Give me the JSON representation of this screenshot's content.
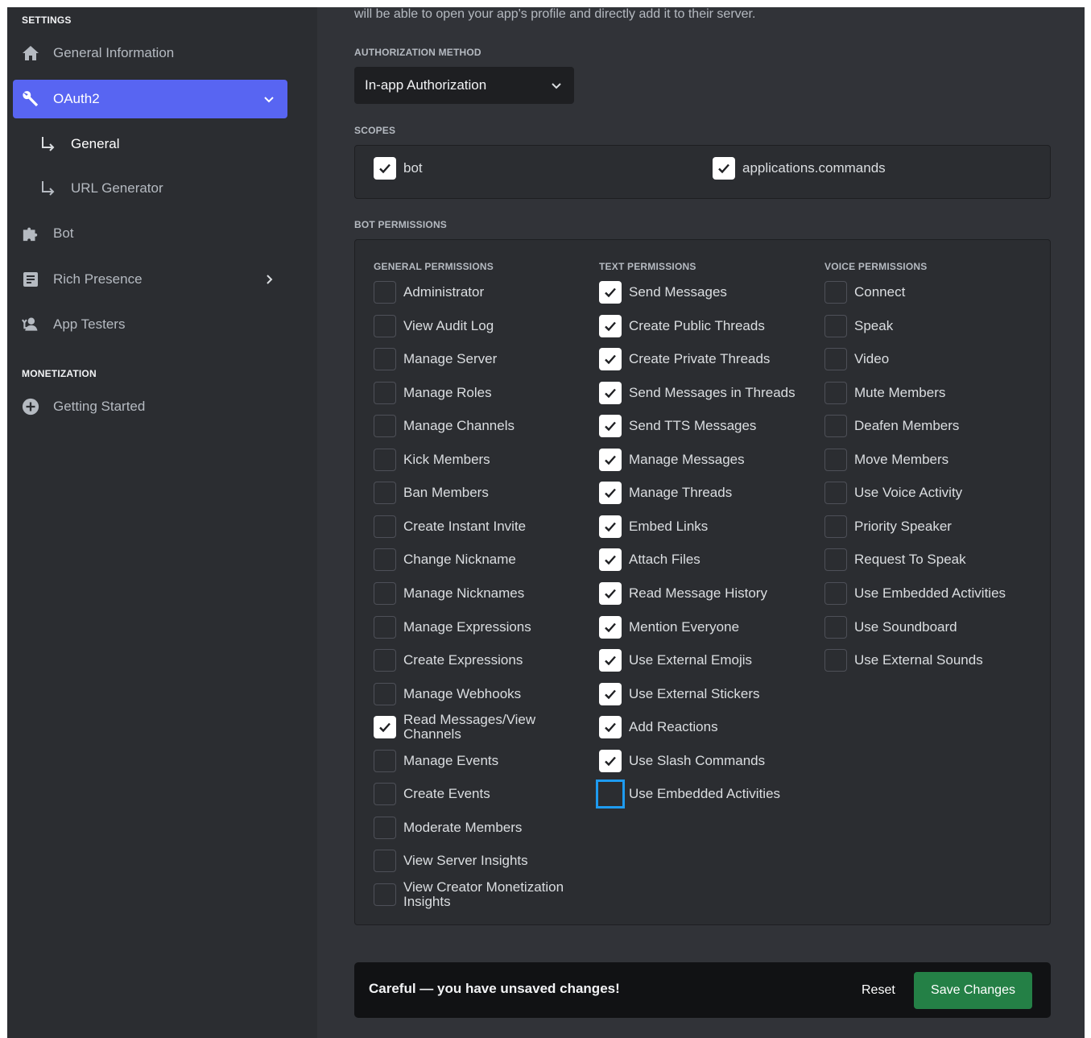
{
  "sidebar": {
    "settings_header": "SETTINGS",
    "items": [
      {
        "label": "General Information",
        "icon": "home-icon"
      },
      {
        "label": "OAuth2",
        "icon": "wrench-icon",
        "active": true
      },
      {
        "label": "General",
        "icon": "subitem-arrow-icon",
        "active": true
      },
      {
        "label": "URL Generator",
        "icon": "subitem-arrow-icon"
      },
      {
        "label": "Bot",
        "icon": "puzzle-icon"
      },
      {
        "label": "Rich Presence",
        "icon": "document-icon"
      },
      {
        "label": "App Testers",
        "icon": "testers-icon"
      }
    ],
    "monetization_header": "MONETIZATION",
    "monetization_items": [
      {
        "label": "Getting Started",
        "icon": "plus-circle-icon"
      }
    ]
  },
  "main": {
    "intro_text": "will be able to open your app's profile and directly add it to their server.",
    "auth_method_header": "AUTHORIZATION METHOD",
    "auth_method_value": "In-app Authorization",
    "scopes_header": "SCOPES",
    "scopes": [
      {
        "label": "bot",
        "checked": true
      },
      {
        "label": "applications.commands",
        "checked": true
      }
    ],
    "bot_permissions_header": "BOT PERMISSIONS",
    "columns": [
      {
        "header": "GENERAL PERMISSIONS",
        "items": [
          {
            "label": "Administrator",
            "checked": false
          },
          {
            "label": "View Audit Log",
            "checked": false
          },
          {
            "label": "Manage Server",
            "checked": false
          },
          {
            "label": "Manage Roles",
            "checked": false
          },
          {
            "label": "Manage Channels",
            "checked": false
          },
          {
            "label": "Kick Members",
            "checked": false
          },
          {
            "label": "Ban Members",
            "checked": false
          },
          {
            "label": "Create Instant Invite",
            "checked": false
          },
          {
            "label": "Change Nickname",
            "checked": false
          },
          {
            "label": "Manage Nicknames",
            "checked": false
          },
          {
            "label": "Manage Expressions",
            "checked": false
          },
          {
            "label": "Create Expressions",
            "checked": false
          },
          {
            "label": "Manage Webhooks",
            "checked": false
          },
          {
            "label": "Read Messages/View Channels",
            "checked": true
          },
          {
            "label": "Manage Events",
            "checked": false
          },
          {
            "label": "Create Events",
            "checked": false
          },
          {
            "label": "Moderate Members",
            "checked": false
          },
          {
            "label": "View Server Insights",
            "checked": false
          },
          {
            "label": "View Creator Monetization Insights",
            "checked": false
          }
        ]
      },
      {
        "header": "TEXT PERMISSIONS",
        "items": [
          {
            "label": "Send Messages",
            "checked": true
          },
          {
            "label": "Create Public Threads",
            "checked": true
          },
          {
            "label": "Create Private Threads",
            "checked": true
          },
          {
            "label": "Send Messages in Threads",
            "checked": true
          },
          {
            "label": "Send TTS Messages",
            "checked": true
          },
          {
            "label": "Manage Messages",
            "checked": true
          },
          {
            "label": "Manage Threads",
            "checked": true
          },
          {
            "label": "Embed Links",
            "checked": true
          },
          {
            "label": "Attach Files",
            "checked": true
          },
          {
            "label": "Read Message History",
            "checked": true
          },
          {
            "label": "Mention Everyone",
            "checked": true
          },
          {
            "label": "Use External Emojis",
            "checked": true
          },
          {
            "label": "Use External Stickers",
            "checked": true
          },
          {
            "label": "Add Reactions",
            "checked": true
          },
          {
            "label": "Use Slash Commands",
            "checked": true
          },
          {
            "label": "Use Embedded Activities",
            "checked": false,
            "focused": true
          }
        ]
      },
      {
        "header": "VOICE PERMISSIONS",
        "items": [
          {
            "label": "Connect",
            "checked": false
          },
          {
            "label": "Speak",
            "checked": false
          },
          {
            "label": "Video",
            "checked": false
          },
          {
            "label": "Mute Members",
            "checked": false
          },
          {
            "label": "Deafen Members",
            "checked": false
          },
          {
            "label": "Move Members",
            "checked": false
          },
          {
            "label": "Use Voice Activity",
            "checked": false
          },
          {
            "label": "Priority Speaker",
            "checked": false
          },
          {
            "label": "Request To Speak",
            "checked": false
          },
          {
            "label": "Use Embedded Activities",
            "checked": false
          },
          {
            "label": "Use Soundboard",
            "checked": false
          },
          {
            "label": "Use External Sounds",
            "checked": false
          }
        ]
      }
    ]
  },
  "notice": {
    "message": "Careful — you have unsaved changes!",
    "reset_label": "Reset",
    "save_label": "Save Changes"
  },
  "colors": {
    "accent": "#5865f2",
    "save": "#248046",
    "focus": "#1e9bf0"
  }
}
